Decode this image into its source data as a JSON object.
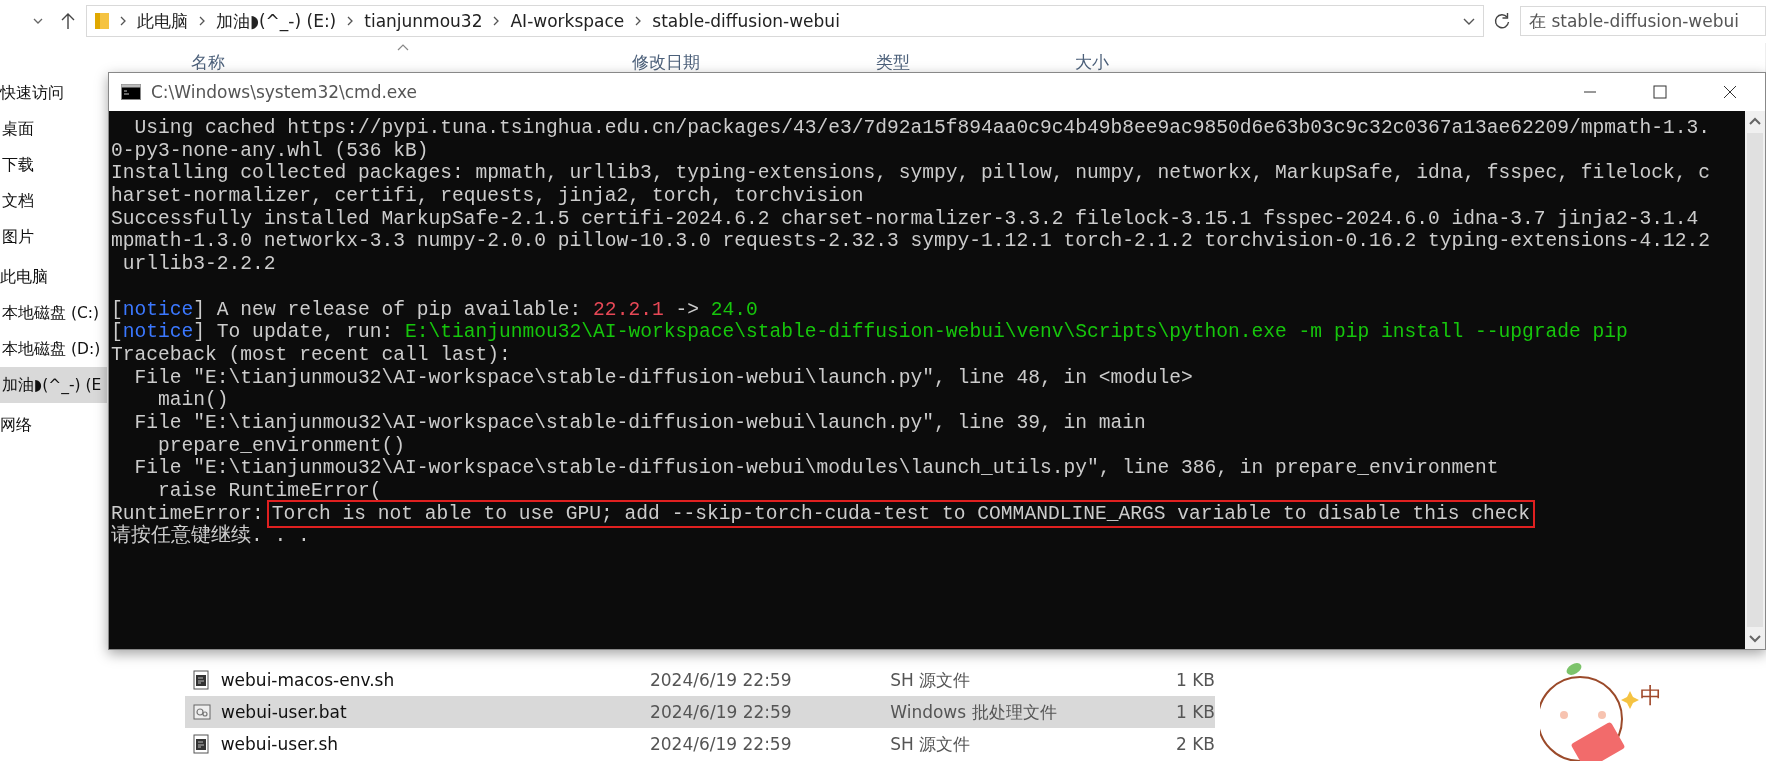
{
  "explorer": {
    "breadcrumbs": [
      "此电脑",
      "加油◗(^_-) (E:)",
      "tianjunmou32",
      "AI-workspace",
      "stable-diffusion-webui"
    ],
    "search": {
      "placeholder": "在 stable-diffusion-webui"
    },
    "sidebar": [
      {
        "label": "快速访问",
        "selected": false,
        "children": [
          {
            "label": "桌面",
            "selected": false
          },
          {
            "label": "下载",
            "selected": false
          },
          {
            "label": "文档",
            "selected": false
          },
          {
            "label": "图片",
            "selected": false
          }
        ]
      },
      {
        "label": "此电脑",
        "selected": false,
        "children": [
          {
            "label": "本地磁盘 (C:)",
            "selected": false
          },
          {
            "label": "本地磁盘 (D:)",
            "selected": false
          },
          {
            "label": "加油◗(^_-) (E",
            "selected": true
          }
        ]
      },
      {
        "label": "网络",
        "selected": false
      }
    ],
    "columns": [
      "名称",
      "修改日期",
      "类型",
      "大小"
    ],
    "files": [
      {
        "name": "webui-macos-env.sh",
        "modified": "2024/6/19 22:59",
        "type": "SH 源文件",
        "size": "1 KB",
        "kind": "script",
        "selected": false
      },
      {
        "name": "webui-user.bat",
        "modified": "2024/6/19 22:59",
        "type": "Windows 批处理文件",
        "size": "1 KB",
        "kind": "batch",
        "selected": true
      },
      {
        "name": "webui-user.sh",
        "modified": "2024/6/19 22:59",
        "type": "SH 源文件",
        "size": "2 KB",
        "kind": "script",
        "selected": false
      }
    ]
  },
  "console": {
    "title": "C:\\Windows\\system32\\cmd.exe",
    "lines": [
      {
        "segments": [
          {
            "kind": "plain",
            "text": "  Using cached https://pypi.tuna.tsinghua.edu.cn/packages/43/e3/7d92a15f894aa0c9c4b49b8ee9ac9850d6e63b03c9c32c0367a13ae62209/mpmath-1.3."
          }
        ]
      },
      {
        "segments": [
          {
            "kind": "plain",
            "text": "0-py3-none-any.whl (536 kB)"
          }
        ]
      },
      {
        "segments": [
          {
            "kind": "plain",
            "text": "Installing collected packages: mpmath, urllib3, typing-extensions, sympy, pillow, numpy, networkx, MarkupSafe, idna, fsspec, filelock, c"
          }
        ]
      },
      {
        "segments": [
          {
            "kind": "plain",
            "text": "harset-normalizer, certifi, requests, jinja2, torch, torchvision"
          }
        ]
      },
      {
        "segments": [
          {
            "kind": "plain",
            "text": "Successfully installed MarkupSafe-2.1.5 certifi-2024.6.2 charset-normalizer-3.3.2 filelock-3.15.1 fsspec-2024.6.0 idna-3.7 jinja2-3.1.4"
          }
        ]
      },
      {
        "segments": [
          {
            "kind": "plain",
            "text": "mpmath-1.3.0 networkx-3.3 numpy-2.0.0 pillow-10.3.0 requests-2.32.3 sympy-1.12.1 torch-2.1.2 torchvision-0.16.2 typing-extensions-4.12.2"
          }
        ]
      },
      {
        "segments": [
          {
            "kind": "plain",
            "text": " urllib3-2.2.2"
          }
        ]
      },
      {
        "blank_before": true,
        "segments": [
          {
            "kind": "plain",
            "text": "["
          },
          {
            "kind": "notice",
            "text": "notice"
          },
          {
            "kind": "plain",
            "text": "] A new release of pip available: "
          },
          {
            "kind": "old",
            "text": "22.2.1"
          },
          {
            "kind": "plain",
            "text": " -> "
          },
          {
            "kind": "new",
            "text": "24.0"
          }
        ]
      },
      {
        "segments": [
          {
            "kind": "plain",
            "text": "["
          },
          {
            "kind": "notice",
            "text": "notice"
          },
          {
            "kind": "plain",
            "text": "] To update, run: "
          },
          {
            "kind": "new",
            "text": "E:\\tianjunmou32\\AI-workspace\\stable-diffusion-webui\\venv\\Scripts\\python.exe -m pip install --upgrade pip"
          }
        ]
      },
      {
        "segments": [
          {
            "kind": "plain",
            "text": "Traceback (most recent call last):"
          }
        ]
      },
      {
        "segments": [
          {
            "kind": "plain",
            "text": "  File \"E:\\tianjunmou32\\AI-workspace\\stable-diffusion-webui\\launch.py\", line 48, in <module>"
          }
        ]
      },
      {
        "segments": [
          {
            "kind": "plain",
            "text": "    main()"
          }
        ]
      },
      {
        "segments": [
          {
            "kind": "plain",
            "text": "  File \"E:\\tianjunmou32\\AI-workspace\\stable-diffusion-webui\\launch.py\", line 39, in main"
          }
        ]
      },
      {
        "segments": [
          {
            "kind": "plain",
            "text": "    prepare_environment()"
          }
        ]
      },
      {
        "segments": [
          {
            "kind": "plain",
            "text": "  File \"E:\\tianjunmou32\\AI-workspace\\stable-diffusion-webui\\modules\\launch_utils.py\", line 386, in prepare_environment"
          }
        ]
      },
      {
        "segments": [
          {
            "kind": "plain",
            "text": "    raise RuntimeError("
          }
        ]
      },
      {
        "segments": [
          {
            "kind": "plain",
            "text": "RuntimeError:"
          },
          {
            "kind": "highlight",
            "text": "Torch is not able to use GPU; add --skip-torch-cuda-test to COMMANDLINE_ARGS variable to disable this check"
          }
        ]
      },
      {
        "segments": [
          {
            "kind": "plain",
            "text": "请按任意键继续. . ."
          }
        ]
      }
    ]
  },
  "sticker": {
    "text": "中"
  }
}
